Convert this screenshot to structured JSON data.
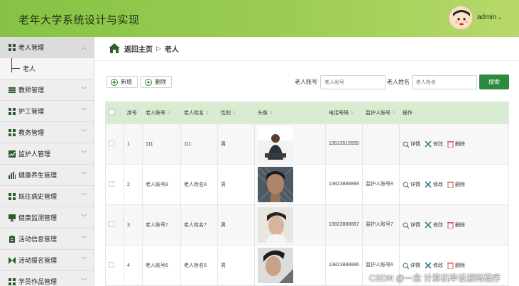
{
  "header": {
    "title": "老年大学系统设计与实现",
    "user": "admin",
    "caret": "⌄"
  },
  "sidebar": {
    "items": [
      {
        "label": "老人管理",
        "icon": "grid-icon"
      },
      {
        "label": "老人",
        "icon": "sub-item"
      },
      {
        "label": "教师管理",
        "icon": "list-icon"
      },
      {
        "label": "护工管理",
        "icon": "grid-icon"
      },
      {
        "label": "教务管理",
        "icon": "grid-icon"
      },
      {
        "label": "监护人管理",
        "icon": "chart-icon"
      },
      {
        "label": "健康养生管理",
        "icon": "bar-chart-icon"
      },
      {
        "label": "既往病史管理",
        "icon": "grid-icon"
      },
      {
        "label": "健康监测管理",
        "icon": "monitor-icon"
      },
      {
        "label": "活动信息管理",
        "icon": "clipboard-icon"
      },
      {
        "label": "活动报名管理",
        "icon": "exchange-icon"
      },
      {
        "label": "学员作品管理",
        "icon": "grid-icon"
      }
    ]
  },
  "breadcrumb": {
    "home": "返回主页",
    "sep": "▷",
    "current": "老人"
  },
  "toolbar": {
    "add_label": "新增",
    "delete_label": "删除",
    "account_label": "老人账号",
    "account_placeholder": "老人账号",
    "name_label": "老人姓名",
    "name_placeholder": "老人姓名",
    "search_label": "搜索"
  },
  "table": {
    "headers": [
      "序号",
      "老人账号",
      "老人姓名",
      "性别",
      "头像",
      "电话号码",
      "监护人账号",
      "操作"
    ],
    "rows": [
      {
        "index": "1",
        "account": "111",
        "name": "111",
        "gender": "男",
        "phone": "13513515555",
        "guardian": ""
      },
      {
        "index": "2",
        "account": "老人账号8",
        "name": "老人姓名8",
        "gender": "男",
        "phone": "13823888888",
        "guardian": "监护人账号8"
      },
      {
        "index": "3",
        "account": "老人账号7",
        "name": "老人姓名7",
        "gender": "男",
        "phone": "13823888887",
        "guardian": "监护人账号7"
      },
      {
        "index": "4",
        "account": "老人账号6",
        "name": "老人姓名6",
        "gender": "男",
        "phone": "13823888886",
        "guardian": "监护人账号6"
      }
    ],
    "ops": {
      "detail": "详情",
      "edit": "修改",
      "delete": "删除"
    }
  },
  "watermark": "CSDN @一念 计算机毕设源码程序",
  "colors": {
    "header": "#86c344",
    "accent": "#2b8a3e",
    "table_header": "#d7ecd0",
    "delete": "#d9534f"
  }
}
